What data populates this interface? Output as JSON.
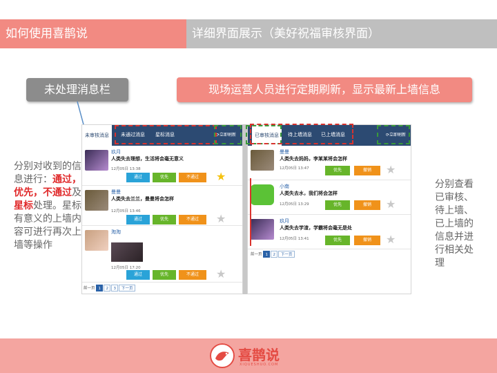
{
  "header": {
    "left_title": "如何使用喜鹊说",
    "right_title": "详细界面展示（美好祝福审核界面）"
  },
  "callouts": {
    "unprocessed": "未处理消息栏",
    "refresh": "现场运营人员进行定期刷新，显示最新上墙信息"
  },
  "notes": {
    "left_line1": "分别对收到的信息进行：",
    "pass": "通过",
    "sep1": "，",
    "priority": "优先",
    "sep2": "，",
    "reject": "不通过",
    "and": "及",
    "star": "星标",
    "tail": "处理。星标有意义的上墙内容可进行再次上墙等操作",
    "right": "分别查看已审核、待上墙、已上墙的信息并进行相关处理"
  },
  "left_panel": {
    "tabs": {
      "unreviewed": "未审核消息",
      "rejected": "未通过消息",
      "starred": "星标消息"
    },
    "refresh": "⟳立即刷新",
    "messages": [
      {
        "name": "玖月",
        "text": "人类失去理想，生活将会毫无意义",
        "time": "12月05日 13:38",
        "btn1": "通过",
        "btn2": "优先",
        "btn3": "不通过",
        "starred": true
      },
      {
        "name": "曼曼",
        "text": "人类失去兰兰，曼曼将会怎样",
        "time": "12月05日 13:46",
        "btn1": "通过",
        "btn2": "优先",
        "btn3": "不通过",
        "starred": false
      },
      {
        "name": "淘淘",
        "text": "",
        "time": "12月05日 17:20",
        "btn1": "通过",
        "btn2": "优先",
        "btn3": "不通过",
        "starred": false
      }
    ],
    "pager": {
      "prev": "前一页",
      "p1": "1",
      "p2": "2",
      "p3": "3",
      "next": "下一页"
    }
  },
  "right_panel": {
    "tabs": {
      "reviewed": "已审核消息",
      "pending": "待上墙消息",
      "posted": "已上墙消息"
    },
    "refresh": "⟳立即刷新",
    "messages": [
      {
        "name": "曼曼",
        "text": "人类失去妈妈，李某某将会怎样",
        "time": "12月05日 13:47",
        "btn1": "优先",
        "btn2": "撤销",
        "starred": false
      },
      {
        "name": "小南",
        "text": "人类失去水，我们将会怎样",
        "time": "12月05日 13:29",
        "btn1": "优先",
        "btn2": "撤销",
        "starred": false
      },
      {
        "name": "玖月",
        "text": "人类失去学渣，学霸将会毫无是处",
        "time": "12月05日 13:41",
        "btn1": "优先",
        "btn2": "撤销",
        "starred": false
      }
    ],
    "pager": {
      "prev": "前一页",
      "p1": "1",
      "p2": "2",
      "next": "下一页"
    }
  },
  "footer": {
    "brand": "喜鹊说",
    "domain": "XIQUESHUO.COM"
  },
  "colors": {
    "accent": "#f28a82",
    "nav": "#2c4a72",
    "pass": "#2aa3d8",
    "priority": "#67b52a",
    "reject": "#f0921a",
    "star": "#f5c211",
    "highlight": "#e0292a"
  }
}
